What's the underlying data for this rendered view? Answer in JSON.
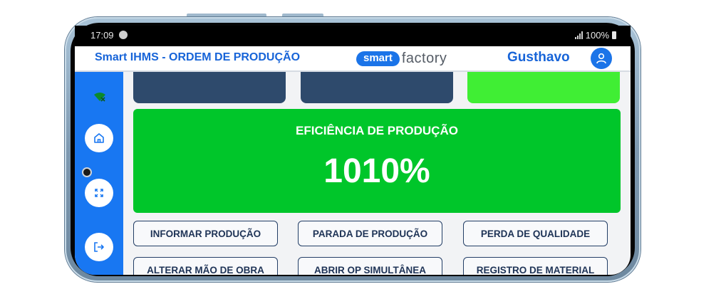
{
  "status_bar": {
    "time": "17:09",
    "battery": "100%"
  },
  "header": {
    "title": "Smart IHMS - ORDEM DE PRODUÇÃO",
    "logo_smart": "smart",
    "logo_factory": "factory",
    "user_name": "Gusthavo"
  },
  "sidebar": {
    "items": [
      {
        "icon": "wifi-icon"
      },
      {
        "icon": "home-icon"
      },
      {
        "icon": "fullscreen-icon"
      },
      {
        "icon": "logout-icon"
      }
    ]
  },
  "efficiency": {
    "label": "EFICIÊNCIA DE PRODUÇÃO",
    "value": "1010%"
  },
  "actions": {
    "row1": [
      "INFORMAR PRODUÇÃO",
      "PARADA DE PRODUÇÃO",
      "PERDA DE QUALIDADE"
    ],
    "row2": [
      "ALTERAR MÃO DE OBRA",
      "ABRIR OP SIMULTÂNEA",
      "REGISTRO DE MATERIAL"
    ]
  },
  "colors": {
    "brand_blue": "#1877f2",
    "efficiency_green": "#00c62a",
    "top_card_dark": "#2e4a6c",
    "top_card_green": "#40ee34"
  }
}
